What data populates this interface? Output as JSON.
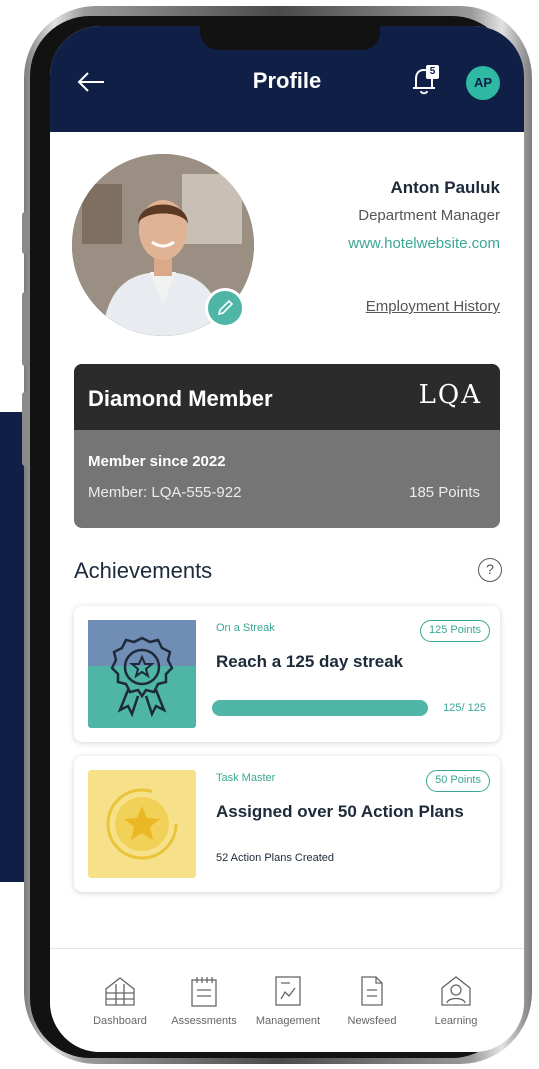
{
  "header": {
    "title": "Profile",
    "notification_count": "5",
    "avatar_initials": "AP"
  },
  "profile": {
    "name": "Anton Pauluk",
    "role": "Department Manager",
    "website": "www.hotelwebsite.com",
    "employment_history_link": "Employment History"
  },
  "membership": {
    "tier": "Diamond Member",
    "logo_text": "LQA",
    "since": "Member since 2022",
    "member_id": "Member: LQA-555-922",
    "points": "185 Points"
  },
  "achievements": {
    "title": "Achievements",
    "help_icon": "?",
    "items": [
      {
        "category": "On a Streak",
        "points": "125 Points",
        "name": "Reach a 125 day streak",
        "progress_text": "125/ 125",
        "progress_fraction": 1.0,
        "icon": "rosette-star-icon",
        "tile_color": "#4fb5a7"
      },
      {
        "category": "Task Master",
        "points": "50 Points",
        "name": "Assigned over 50 Action Plans",
        "subtext": "52 Action Plans Created",
        "icon": "star-medal-icon",
        "tile_color": "#f6e08a"
      }
    ]
  },
  "nav": [
    {
      "label": "Dashboard",
      "icon": "dashboard-icon"
    },
    {
      "label": "Assessments",
      "icon": "assessments-icon"
    },
    {
      "label": "Management",
      "icon": "management-icon"
    },
    {
      "label": "Newsfeed",
      "icon": "newsfeed-icon"
    },
    {
      "label": "Learning",
      "icon": "learning-icon"
    }
  ],
  "colors": {
    "header_bg": "#0f1f45",
    "accent": "#3aa794",
    "card_dark": "#2b2b2b",
    "card_gray": "#757575"
  }
}
